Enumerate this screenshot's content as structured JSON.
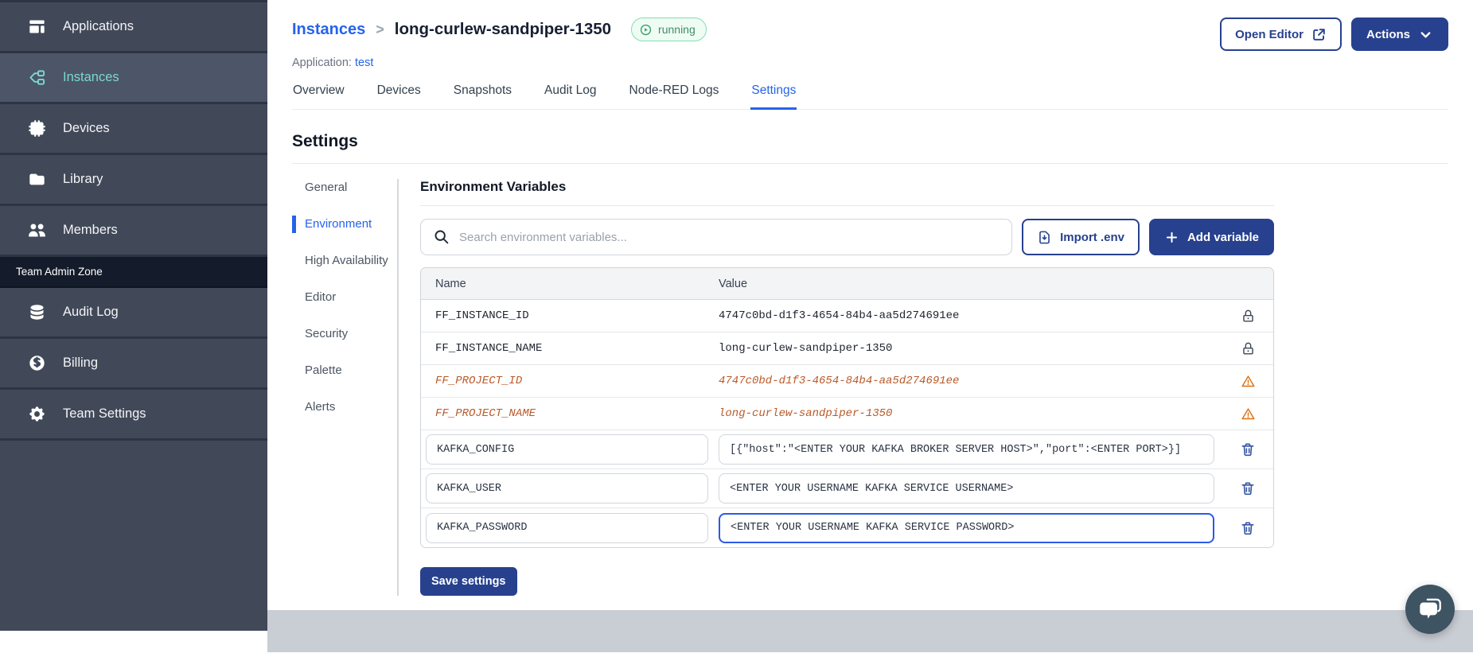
{
  "sidebar": {
    "items": [
      {
        "label": "Applications",
        "icon": "applications-icon",
        "active": false
      },
      {
        "label": "Instances",
        "icon": "instances-icon",
        "active": true
      },
      {
        "label": "Devices",
        "icon": "devices-icon",
        "active": false
      },
      {
        "label": "Library",
        "icon": "library-icon",
        "active": false
      },
      {
        "label": "Members",
        "icon": "members-icon",
        "active": false
      }
    ],
    "section_label": "Team Admin Zone",
    "admin_items": [
      {
        "label": "Audit Log",
        "icon": "audit-log-icon"
      },
      {
        "label": "Billing",
        "icon": "billing-icon"
      },
      {
        "label": "Team Settings",
        "icon": "team-settings-icon"
      }
    ]
  },
  "header": {
    "breadcrumb_parent": "Instances",
    "breadcrumb_separator": ">",
    "instance_name": "long-curlew-sandpiper-1350",
    "status": "running",
    "application_label": "Application:",
    "application_name": "test",
    "open_editor": "Open Editor",
    "actions": "Actions"
  },
  "tabs": [
    {
      "label": "Overview",
      "active": false
    },
    {
      "label": "Devices",
      "active": false
    },
    {
      "label": "Snapshots",
      "active": false
    },
    {
      "label": "Audit Log",
      "active": false
    },
    {
      "label": "Node-RED Logs",
      "active": false
    },
    {
      "label": "Settings",
      "active": true
    }
  ],
  "settings": {
    "title": "Settings",
    "nav": [
      {
        "label": "General",
        "active": false
      },
      {
        "label": "Environment",
        "active": true
      },
      {
        "label": "High Availability",
        "active": false
      },
      {
        "label": "Editor",
        "active": false
      },
      {
        "label": "Security",
        "active": false
      },
      {
        "label": "Palette",
        "active": false
      },
      {
        "label": "Alerts",
        "active": false
      }
    ],
    "env": {
      "title": "Environment Variables",
      "search_placeholder": "Search environment variables...",
      "import_button": "Import .env",
      "add_button": "Add variable",
      "columns": {
        "name": "Name",
        "value": "Value"
      },
      "rows": [
        {
          "name": "FF_INSTANCE_ID",
          "value": "4747c0bd-d1f3-4654-84b4-aa5d274691ee",
          "state": "locked"
        },
        {
          "name": "FF_INSTANCE_NAME",
          "value": "long-curlew-sandpiper-1350",
          "state": "locked"
        },
        {
          "name": "FF_PROJECT_ID",
          "value": "4747c0bd-d1f3-4654-84b4-aa5d274691ee",
          "state": "deprecated"
        },
        {
          "name": "FF_PROJECT_NAME",
          "value": "long-curlew-sandpiper-1350",
          "state": "deprecated"
        },
        {
          "name": "KAFKA_CONFIG",
          "value": "[{\"host\":\"<ENTER YOUR KAFKA BROKER SERVER HOST>\",\"port\":<ENTER PORT>}]",
          "state": "editable"
        },
        {
          "name": "KAFKA_USER",
          "value": "<ENTER YOUR USERNAME KAFKA SERVICE USERNAME>",
          "state": "editable"
        },
        {
          "name": "KAFKA_PASSWORD",
          "value": "<ENTER YOUR USERNAME KAFKA SERVICE PASSWORD>",
          "state": "editable",
          "focused": true
        }
      ],
      "save_button": "Save settings"
    }
  },
  "colors": {
    "navy": "#27418E",
    "link_blue": "#2563EB",
    "sidebar_teal": "#7AD9CF",
    "running_green": "#38A169",
    "deprecated_orange": "#BB5A28",
    "warning_orange": "#DD7011",
    "sidebar_bg": "#414959",
    "footer_gray": "#C9CDD4"
  }
}
